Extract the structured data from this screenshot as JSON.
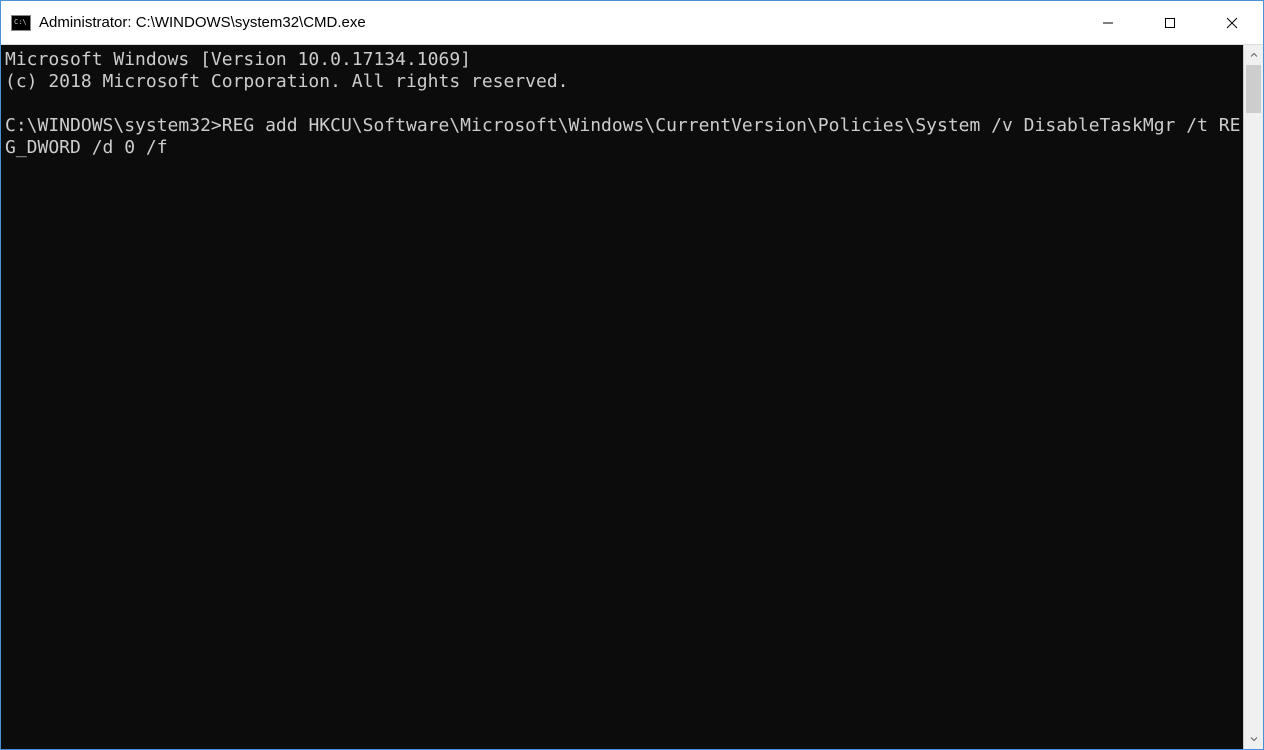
{
  "window": {
    "title": "Administrator: C:\\WINDOWS\\system32\\CMD.exe"
  },
  "console": {
    "line1": "Microsoft Windows [Version 10.0.17134.1069]",
    "line2": "(c) 2018 Microsoft Corporation. All rights reserved.",
    "blank1": "",
    "prompt": "C:\\WINDOWS\\system32>",
    "command": "REG add HKCU\\Software\\Microsoft\\Windows\\CurrentVersion\\Policies\\System /v DisableTaskMgr /t REG_DWORD /d 0 /f"
  }
}
